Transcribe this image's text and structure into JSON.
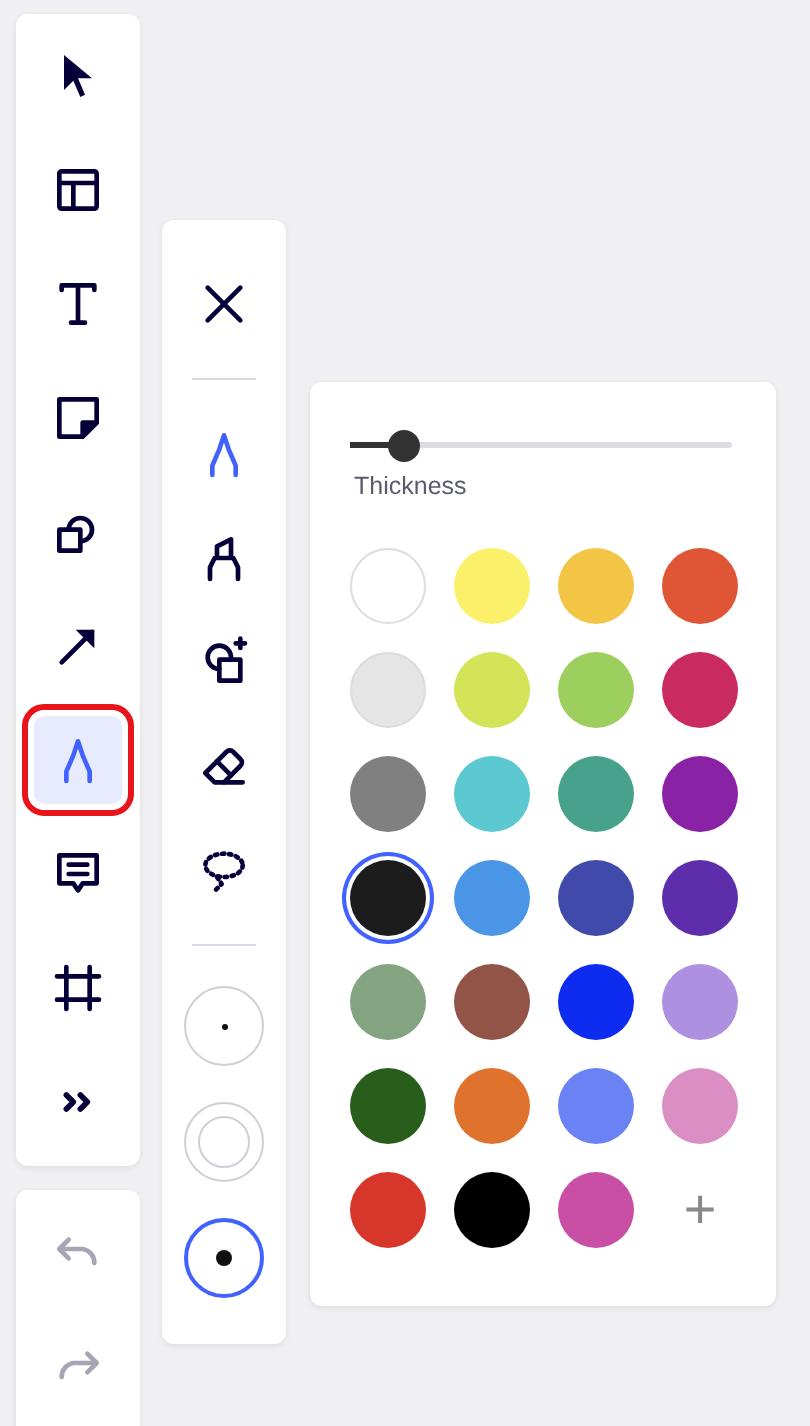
{
  "main_toolbar": {
    "tools": [
      {
        "kind": "select",
        "selected": false
      },
      {
        "kind": "template",
        "selected": false
      },
      {
        "kind": "text",
        "selected": false
      },
      {
        "kind": "sticky",
        "selected": false
      },
      {
        "kind": "shapes",
        "selected": false
      },
      {
        "kind": "arrow",
        "selected": false
      },
      {
        "kind": "pen",
        "selected": true
      },
      {
        "kind": "comment",
        "selected": false
      },
      {
        "kind": "frame",
        "selected": false
      },
      {
        "kind": "more",
        "selected": false
      }
    ]
  },
  "history": [
    {
      "kind": "undo",
      "disabled": true
    },
    {
      "kind": "redo",
      "disabled": true
    }
  ],
  "pen_panel": {
    "pens": [
      {
        "kind": "pen",
        "selected": true
      },
      {
        "kind": "highlighter",
        "selected": false
      },
      {
        "kind": "smart",
        "selected": false
      },
      {
        "kind": "eraser",
        "selected": false
      },
      {
        "kind": "lasso",
        "selected": false
      }
    ],
    "sizes": [
      {
        "kind": "small",
        "selected": false
      },
      {
        "kind": "large",
        "selected": false
      },
      {
        "kind": "medium",
        "selected": true
      }
    ]
  },
  "color_panel": {
    "thickness": {
      "label": "Thickness",
      "level": 0.14
    },
    "colors": [
      {
        "color": "#ffffff",
        "selected": false
      },
      {
        "color": "#fbf06a",
        "selected": false
      },
      {
        "color": "#f2c545",
        "selected": false
      },
      {
        "color": "#e05536",
        "selected": false
      },
      {
        "color": "#e5e5e5",
        "selected": false
      },
      {
        "color": "#d3e458",
        "selected": false
      },
      {
        "color": "#9ccf5e",
        "selected": false
      },
      {
        "color": "#c92a60",
        "selected": false
      },
      {
        "color": "#808080",
        "selected": false
      },
      {
        "color": "#5cc8d0",
        "selected": false
      },
      {
        "color": "#48a18a",
        "selected": false
      },
      {
        "color": "#8a22a6",
        "selected": false
      },
      {
        "color": "#1c1c1c",
        "selected": true
      },
      {
        "color": "#4a95e6",
        "selected": false
      },
      {
        "color": "#3f4aab",
        "selected": false
      },
      {
        "color": "#5e2dac",
        "selected": false
      },
      {
        "color": "#84a381",
        "selected": false
      },
      {
        "color": "#925447",
        "selected": false
      },
      {
        "color": "#0d2cf0",
        "selected": false
      },
      {
        "color": "#ad90df",
        "selected": false
      },
      {
        "color": "#295d1b",
        "selected": false
      },
      {
        "color": "#df722d",
        "selected": false
      },
      {
        "color": "#6a82f3",
        "selected": false
      },
      {
        "color": "#da8ec4",
        "selected": false
      },
      {
        "color": "#d7372b",
        "selected": false
      },
      {
        "color": "#000000",
        "selected": false
      },
      {
        "color": "#c94fa4",
        "selected": false
      }
    ],
    "add_label": "+"
  }
}
